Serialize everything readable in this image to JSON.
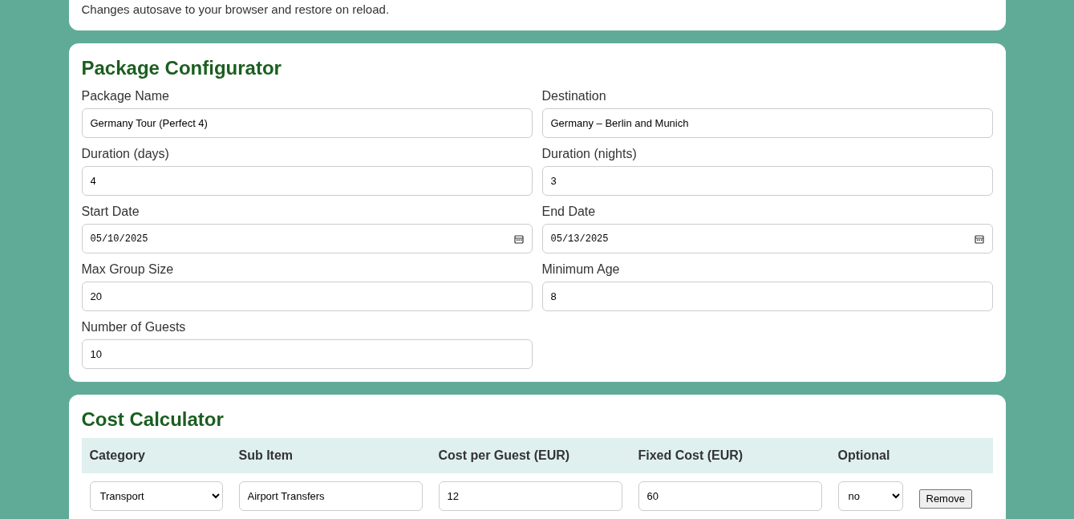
{
  "note": "Changes autosave to your browser and restore on reload.",
  "configurator": {
    "title": "Package Configurator",
    "fields": [
      {
        "label": "Package Name",
        "value": "Germany Tour (Perfect 4)",
        "kind": "text"
      },
      {
        "label": "Destination",
        "value": "Germany – Berlin and Munich",
        "kind": "text"
      },
      {
        "label": "Duration (days)",
        "value": "4",
        "kind": "text"
      },
      {
        "label": "Duration (nights)",
        "value": "3",
        "kind": "text"
      },
      {
        "label": "Start Date",
        "value": "05/10/2025",
        "kind": "date"
      },
      {
        "label": "End Date",
        "value": "05/13/2025",
        "kind": "date"
      },
      {
        "label": "Max Group Size",
        "value": "20",
        "kind": "text"
      },
      {
        "label": "Minimum Age",
        "value": "8",
        "kind": "text"
      },
      {
        "label": "Number of Guests",
        "value": "10",
        "kind": "text"
      }
    ]
  },
  "cost_calculator": {
    "title": "Cost Calculator",
    "columns": [
      "Category",
      "Sub Item",
      "Cost per Guest (EUR)",
      "Fixed Cost (EUR)",
      "Optional"
    ],
    "rows": [
      {
        "category": "Transport",
        "sub_item": "Airport Transfers",
        "cost_per_guest": "12",
        "fixed_cost": "60",
        "optional": "no",
        "action": "Remove"
      }
    ]
  }
}
